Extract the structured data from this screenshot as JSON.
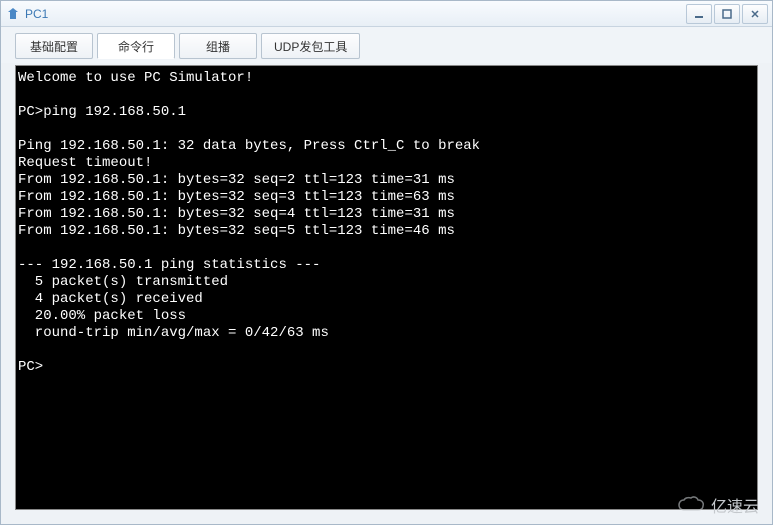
{
  "window": {
    "title": "PC1"
  },
  "tabs": [
    {
      "label": "基础配置"
    },
    {
      "label": "命令行"
    },
    {
      "label": "组播"
    },
    {
      "label": "UDP发包工具"
    }
  ],
  "terminal": {
    "welcome": "Welcome to use PC Simulator!",
    "command": "PC>ping 192.168.50.1",
    "ping_header": "Ping 192.168.50.1: 32 data bytes, Press Ctrl_C to break",
    "timeout": "Request timeout!",
    "replies": [
      "From 192.168.50.1: bytes=32 seq=2 ttl=123 time=31 ms",
      "From 192.168.50.1: bytes=32 seq=3 ttl=123 time=63 ms",
      "From 192.168.50.1: bytes=32 seq=4 ttl=123 time=31 ms",
      "From 192.168.50.1: bytes=32 seq=5 ttl=123 time=46 ms"
    ],
    "stats_header": "--- 192.168.50.1 ping statistics ---",
    "stats_transmitted": "  5 packet(s) transmitted",
    "stats_received": "  4 packet(s) received",
    "stats_loss": "  20.00% packet loss",
    "stats_rtt": "  round-trip min/avg/max = 0/42/63 ms",
    "prompt": "PC>"
  },
  "watermark": {
    "text": "亿速云"
  }
}
